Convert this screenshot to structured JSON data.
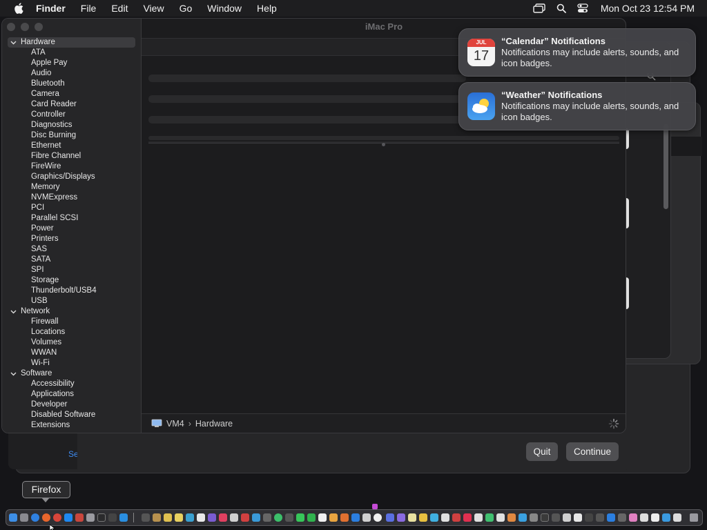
{
  "menubar": {
    "app_name": "Finder",
    "menus": [
      "File",
      "Edit",
      "View",
      "Go",
      "Window",
      "Help"
    ],
    "clock": "Mon Oct 23  12:54 PM",
    "status_icons": [
      "screen-mirroring-icon",
      "search-icon",
      "control-center-icon"
    ]
  },
  "window": {
    "title": "iMac Pro"
  },
  "sidebar": {
    "sections": [
      {
        "label": "Hardware",
        "selected": true,
        "items": [
          "ATA",
          "Apple Pay",
          "Audio",
          "Bluetooth",
          "Camera",
          "Card Reader",
          "Controller",
          "Diagnostics",
          "Disc Burning",
          "Ethernet",
          "Fibre Channel",
          "FireWire",
          "Graphics/Displays",
          "Memory",
          "NVMExpress",
          "PCI",
          "Parallel SCSI",
          "Power",
          "Printers",
          "SAS",
          "SATA",
          "SPI",
          "Storage",
          "Thunderbolt/USB4",
          "USB"
        ]
      },
      {
        "label": "Network",
        "selected": false,
        "items": [
          "Firewall",
          "Locations",
          "Volumes",
          "WWAN",
          "Wi-Fi"
        ]
      },
      {
        "label": "Software",
        "selected": false,
        "items": [
          "Accessibility",
          "Applications",
          "Developer",
          "Disabled Software",
          "Extensions"
        ]
      }
    ]
  },
  "pathbar": {
    "computer": "VM4",
    "separator": "›",
    "section": "Hardware"
  },
  "sheet": {
    "quit_label": "Quit",
    "continue_label": "Continue",
    "partial_link": "Se"
  },
  "notifications": [
    {
      "app": "calendar",
      "title": "“Calendar” Notifications",
      "body": "Notifications may include alerts, sounds, and icon badges.",
      "icon_month": "JUL",
      "icon_day": "17"
    },
    {
      "app": "weather",
      "title": "“Weather” Notifications",
      "body": "Notifications may include alerts, sounds, and icon badges."
    }
  ],
  "tooltip": {
    "label": "Firefox"
  },
  "colors": {
    "accent_red": "#e0433c",
    "weather_blue": "#2e7ee0",
    "dock_dot_purple": "#c64bd6"
  }
}
